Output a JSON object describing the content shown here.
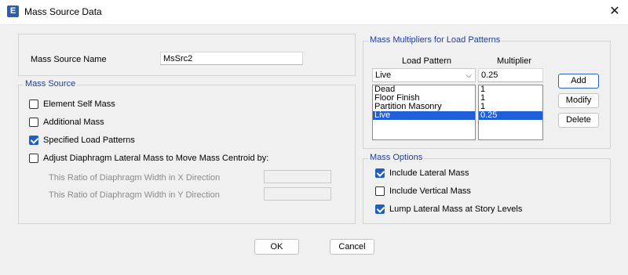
{
  "window": {
    "title": "Mass Source Data",
    "app_icon_letter": "E",
    "close_glyph": "✕"
  },
  "name_section": {
    "label": "Mass Source Name",
    "value": "MsSrc2"
  },
  "mass_source": {
    "title": "Mass Source",
    "element_self_mass": {
      "label": "Element Self Mass",
      "checked": false
    },
    "additional_mass": {
      "label": "Additional Mass",
      "checked": false
    },
    "specified_load_patterns": {
      "label": "Specified Load Patterns",
      "checked": true
    },
    "adjust_diaphragm": {
      "label": "Adjust Diaphragm Lateral Mass to Move Mass Centroid by:",
      "checked": false
    },
    "ratio_x_label": "This Ratio of Diaphragm Width in X Direction",
    "ratio_y_label": "This Ratio of Diaphragm Width in Y Direction",
    "ratio_x_value": "",
    "ratio_y_value": ""
  },
  "multipliers": {
    "title": "Mass Multipliers for Load Patterns",
    "col_load_pattern": "Load Pattern",
    "col_multiplier": "Multiplier",
    "selected_pattern": "Live",
    "multiplier_value": "0.25",
    "patterns": [
      "Dead",
      "Floor Finish",
      "Partition Masonry",
      "Live"
    ],
    "values": [
      "1",
      "1",
      "1",
      "0.25"
    ],
    "add_label": "Add",
    "modify_label": "Modify",
    "delete_label": "Delete"
  },
  "mass_options": {
    "title": "Mass Options",
    "include_lateral": {
      "label": "Include Lateral Mass",
      "checked": true
    },
    "include_vertical": {
      "label": "Include Vertical Mass",
      "checked": false
    },
    "lump_lateral": {
      "label": "Lump Lateral Mass at Story Levels",
      "checked": true
    }
  },
  "footer": {
    "ok_label": "OK",
    "cancel_label": "Cancel"
  },
  "colors": {
    "accent": "#1f5fbf",
    "group_title": "#1f3d9a",
    "selection": "#1f5fd9"
  }
}
